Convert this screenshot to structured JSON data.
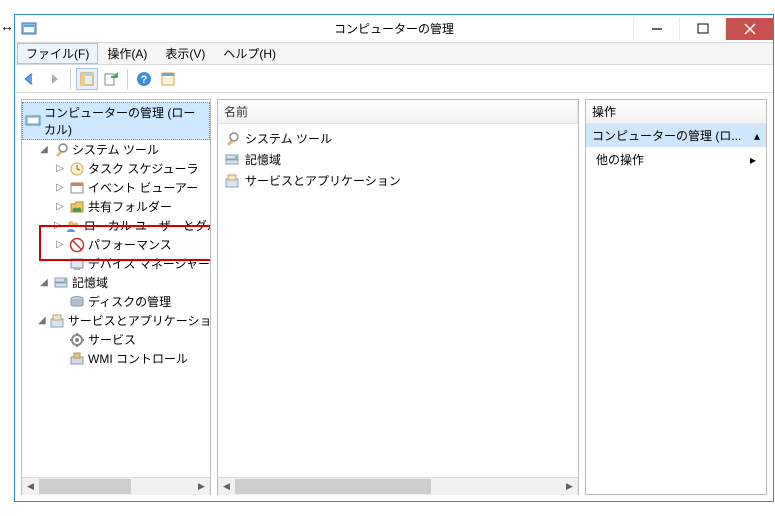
{
  "titlebar": {
    "title": "コンピューターの管理"
  },
  "menubar": {
    "items": [
      "ファイル(F)",
      "操作(A)",
      "表示(V)",
      "ヘルプ(H)"
    ]
  },
  "tree": {
    "root": {
      "label": "コンピューターの管理 (ローカル)",
      "children": [
        {
          "label": "システム ツール",
          "children": [
            "タスク スケジューラ",
            "イベント ビューアー",
            "共有フォルダー",
            "ローカル ユーザーとグループ",
            "パフォーマンス",
            "デバイス マネージャー"
          ]
        },
        {
          "label": "記憶域",
          "children": [
            "ディスクの管理"
          ]
        },
        {
          "label": "サービスとアプリケーション",
          "children": [
            "サービス",
            "WMI コントロール"
          ]
        }
      ]
    }
  },
  "list": {
    "columns": [
      "名前"
    ],
    "items": [
      "システム ツール",
      "記憶域",
      "サービスとアプリケーション"
    ]
  },
  "actions": {
    "header": "操作",
    "group": "コンピューターの管理 (ロ...",
    "items": [
      "他の操作"
    ]
  }
}
